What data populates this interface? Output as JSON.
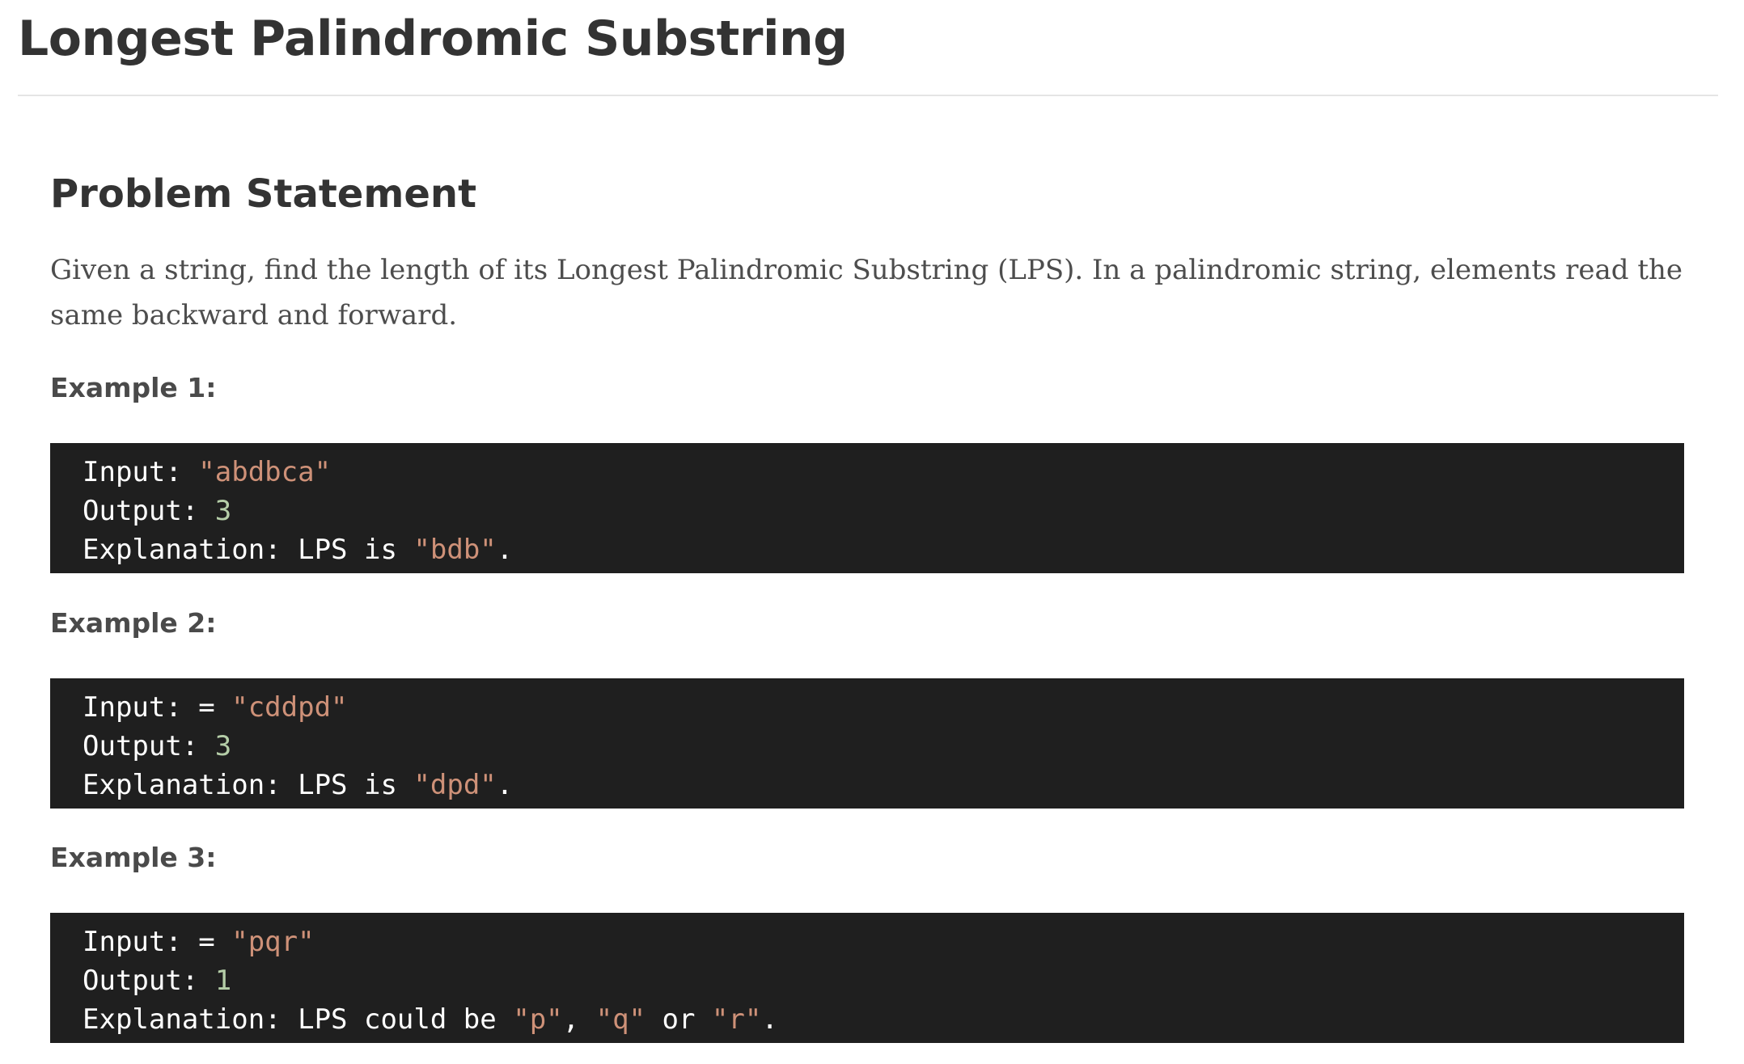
{
  "page": {
    "title": "Longest Palindromic Substring",
    "section_heading": "Problem Statement",
    "statement": "Given a string, find the length of its Longest Palindromic Substring (LPS). In a palindromic string, elements read the same backward and forward."
  },
  "examples": [
    {
      "label": "Example 1:",
      "input_prefix": "Input: ",
      "input_value": "\"abdbca\"",
      "output_prefix": "Output: ",
      "output_value": "3",
      "explanation_prefix": "Explanation: LPS is ",
      "explanation_value": "\"bdb\"",
      "explanation_suffix": "."
    },
    {
      "label": "Example 2:",
      "input_prefix": "Input: = ",
      "input_value": "\"cddpd\"",
      "output_prefix": "Output: ",
      "output_value": "3",
      "explanation_prefix": "Explanation: LPS is ",
      "explanation_value": "\"dpd\"",
      "explanation_suffix": "."
    },
    {
      "label": "Example 3:",
      "input_prefix": "Input: = ",
      "input_value": "\"pqr\"",
      "output_prefix": "Output: ",
      "output_value": "1",
      "explanation_prefix": "Explanation: LPS could be ",
      "explanation_value_1": "\"p\"",
      "explanation_sep_1": ", ",
      "explanation_value_2": "\"q\"",
      "explanation_sep_2": " or ",
      "explanation_value_3": "\"r\"",
      "explanation_suffix": "."
    }
  ],
  "colors": {
    "code_background": "#1f1f1f",
    "code_text": "#ffffff",
    "string_literal": "#ce9178",
    "number_literal": "#b5cea8"
  }
}
